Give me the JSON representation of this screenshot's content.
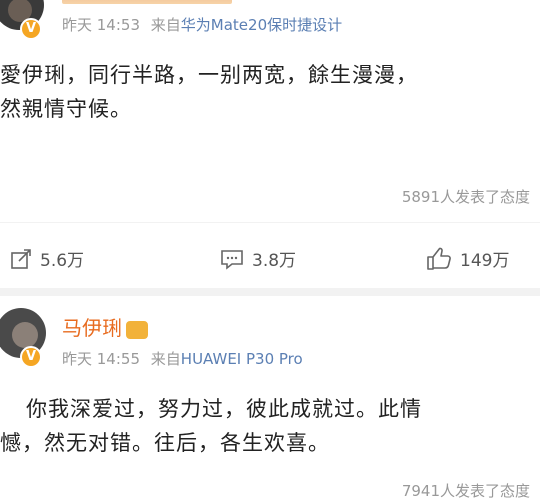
{
  "post1": {
    "meta_time": "昨天 14:53",
    "meta_source_prefix": "来自",
    "meta_source": "华为Mate20保时捷设计",
    "body_line1": "愛伊琍，同行半路，一别两宽，餘生漫漫，",
    "body_line2": "然親情守候。",
    "attitude_count": "5891人发表了态度",
    "repost_count": "5.6万",
    "comment_count": "3.8万",
    "like_count": "149万"
  },
  "post2": {
    "author_name": "马伊琍",
    "meta_time": "昨天 14:55",
    "meta_source_prefix": "来自",
    "meta_source": "HUAWEI P30 Pro",
    "body_line1": "你我深爱过，努力过，彼此成就过。此情",
    "body_line2": "憾，然无对错。往后，各生欢喜。",
    "attitude_count": "7941人发表了态度"
  },
  "icons": {
    "repost": "repost-icon",
    "comment": "comment-icon",
    "like": "like-icon",
    "verified": "verified-badge-icon",
    "member": "crown-icon"
  },
  "colors": {
    "name": "#e86b1f",
    "source": "#5b7fb3",
    "meta": "#999999",
    "verified": "#f5a623"
  }
}
